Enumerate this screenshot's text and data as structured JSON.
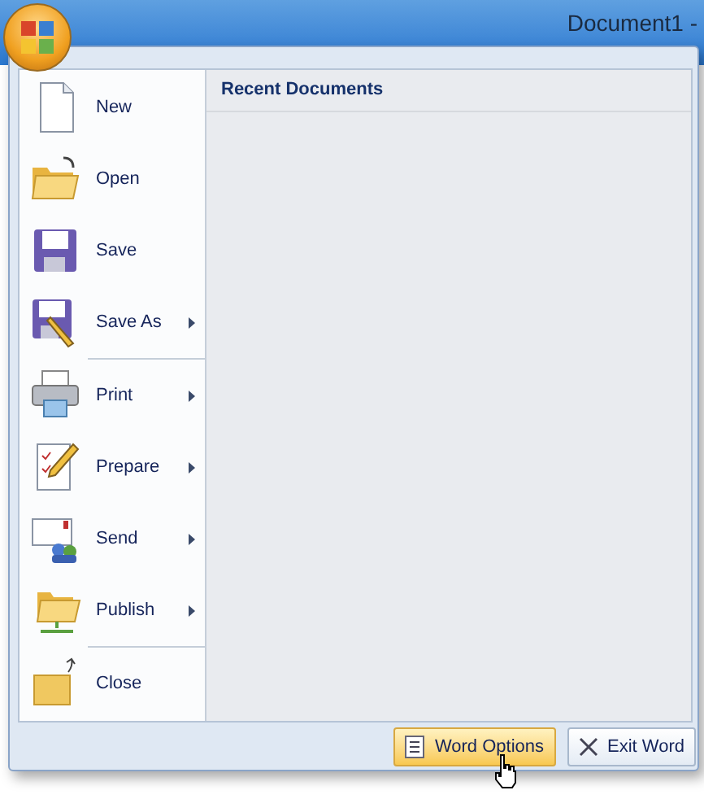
{
  "window": {
    "title": "Document1 -"
  },
  "menu": {
    "items": [
      {
        "label": "New",
        "submenu": false,
        "separator_after": false
      },
      {
        "label": "Open",
        "submenu": false,
        "separator_after": false
      },
      {
        "label": "Save",
        "submenu": false,
        "separator_after": false
      },
      {
        "label": "Save As",
        "submenu": true,
        "separator_after": true
      },
      {
        "label": "Print",
        "submenu": true,
        "separator_after": false
      },
      {
        "label": "Prepare",
        "submenu": true,
        "separator_after": false
      },
      {
        "label": "Send",
        "submenu": true,
        "separator_after": false
      },
      {
        "label": "Publish",
        "submenu": true,
        "separator_after": true
      },
      {
        "label": "Close",
        "submenu": false,
        "separator_after": false
      }
    ]
  },
  "recent_documents": {
    "title": "Recent Documents"
  },
  "buttons": [
    {
      "label": "Word Options",
      "kind": "options",
      "selected": true
    },
    {
      "label": "Exit Word",
      "kind": "exit",
      "selected": false
    }
  ]
}
